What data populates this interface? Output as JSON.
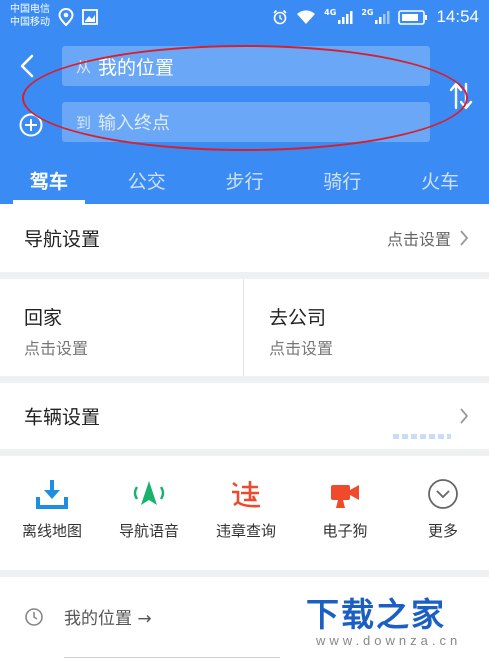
{
  "status_bar": {
    "carrier_1": "中国电信",
    "carrier_2": "中国移动",
    "net_1": "4G",
    "net_2": "2G",
    "time": "14:54"
  },
  "route": {
    "from_prefix": "从",
    "from_value": "我的位置",
    "to_prefix": "到",
    "to_placeholder": "输入终点"
  },
  "tabs": [
    {
      "label": "驾车",
      "active": true
    },
    {
      "label": "公交",
      "active": false
    },
    {
      "label": "步行",
      "active": false
    },
    {
      "label": "骑行",
      "active": false
    },
    {
      "label": "火车",
      "active": false
    }
  ],
  "nav_settings": {
    "label": "导航设置",
    "action": "点击设置"
  },
  "places": {
    "home": {
      "title": "回家",
      "sub": "点击设置"
    },
    "company": {
      "title": "去公司",
      "sub": "点击设置"
    }
  },
  "vehicle": {
    "label": "车辆设置"
  },
  "tools": [
    {
      "label": "离线地图",
      "icon": "download-icon",
      "color": "#1e8fe0"
    },
    {
      "label": "导航语音",
      "icon": "navigation-voice-icon",
      "color": "#17b36b"
    },
    {
      "label": "违章查询",
      "icon": "violation-icon",
      "color": "#ef4a2c"
    },
    {
      "label": "电子狗",
      "icon": "camera-icon",
      "color": "#ef4a2c"
    },
    {
      "label": "更多",
      "icon": "chevron-circle-icon",
      "color": "#666666"
    }
  ],
  "history": {
    "text": "我的位置 →"
  },
  "watermark": {
    "title": "下载之家",
    "url": "www.downza.cn"
  },
  "colors": {
    "header": "#3a8cf4",
    "annotation": "#d8202c"
  }
}
